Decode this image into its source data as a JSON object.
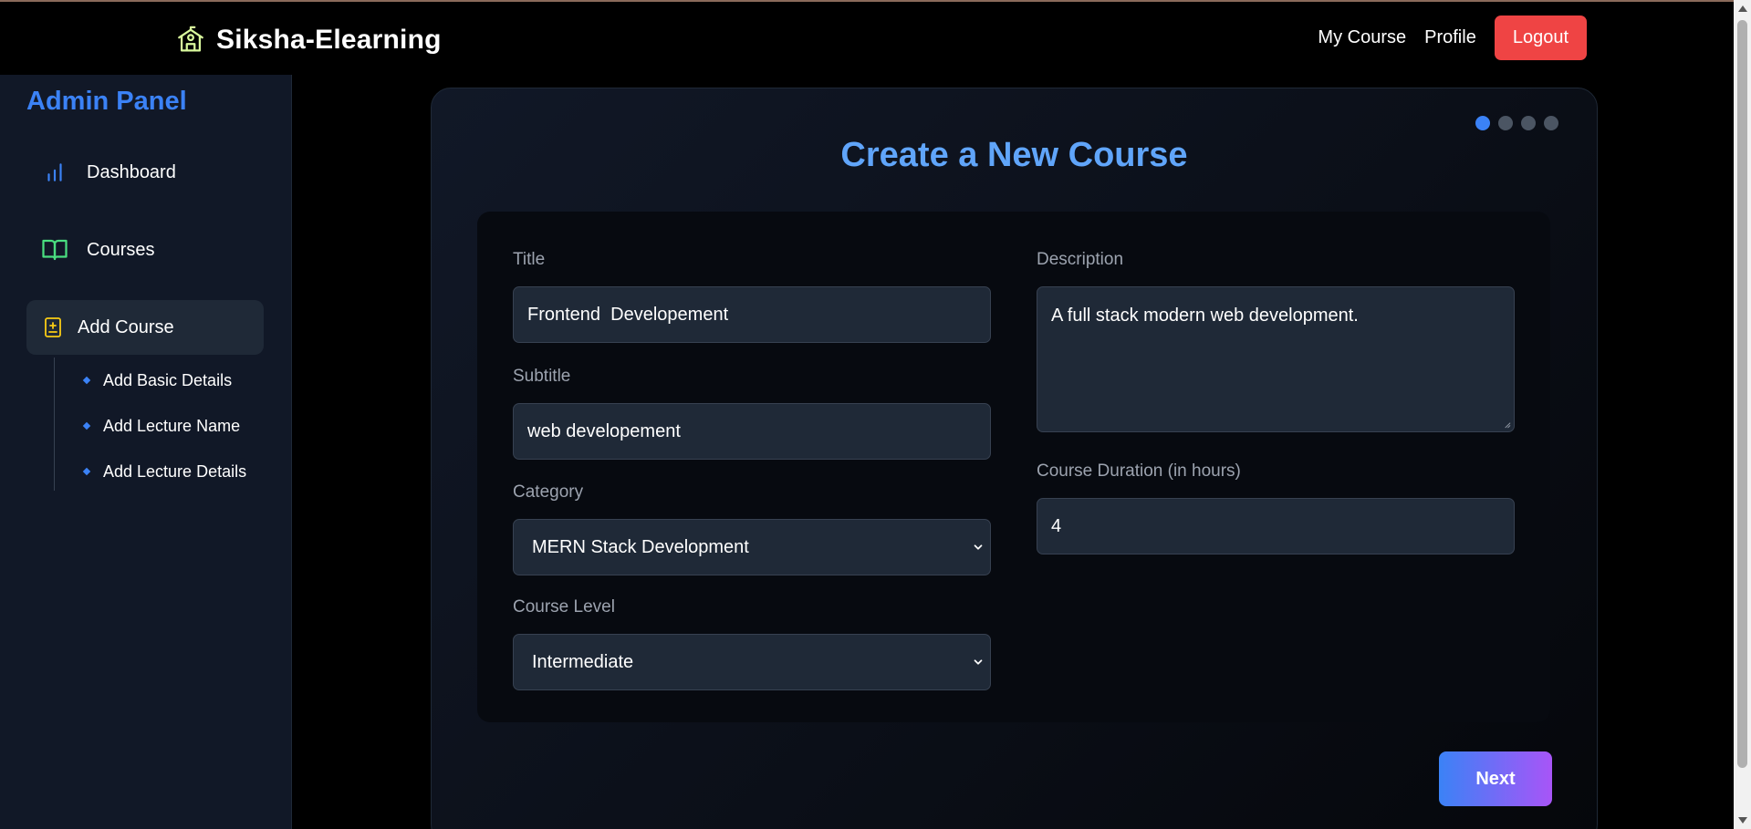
{
  "header": {
    "brand_name": "Siksha-Elearning",
    "brand_icon": "school-icon",
    "nav": {
      "my_course": "My Course",
      "profile": "Profile",
      "logout": "Logout"
    },
    "logout_color": "#ef4444"
  },
  "sidebar": {
    "title": "Admin Panel",
    "items": [
      {
        "label": "Dashboard",
        "icon": "bar-chart-icon"
      },
      {
        "label": "Courses",
        "icon": "book-open-icon"
      },
      {
        "label": "Add Course",
        "icon": "book-plus-icon",
        "active": true
      }
    ],
    "sub_items": [
      {
        "label": "Add Basic Details"
      },
      {
        "label": "Add Lecture Name"
      },
      {
        "label": "Add Lecture Details"
      }
    ]
  },
  "main": {
    "title": "Create a New Course",
    "steps": {
      "total": 4,
      "current": 1
    },
    "form": {
      "title": {
        "label": "Title",
        "value": "Frontend  Developement"
      },
      "subtitle": {
        "label": "Subtitle",
        "value": "web developement"
      },
      "category": {
        "label": "Category",
        "value": "MERN Stack Development"
      },
      "level": {
        "label": "Course Level",
        "value": "Intermediate"
      },
      "description": {
        "label": "Description",
        "value": "A full stack modern web development."
      },
      "duration": {
        "label": "Course Duration (in hours)",
        "value": "4"
      }
    },
    "next_label": "Next"
  },
  "colors": {
    "accent": "#3b82f6",
    "title": "#60a5fa",
    "next_gradient": [
      "#3b82f6",
      "#a855f7"
    ]
  }
}
